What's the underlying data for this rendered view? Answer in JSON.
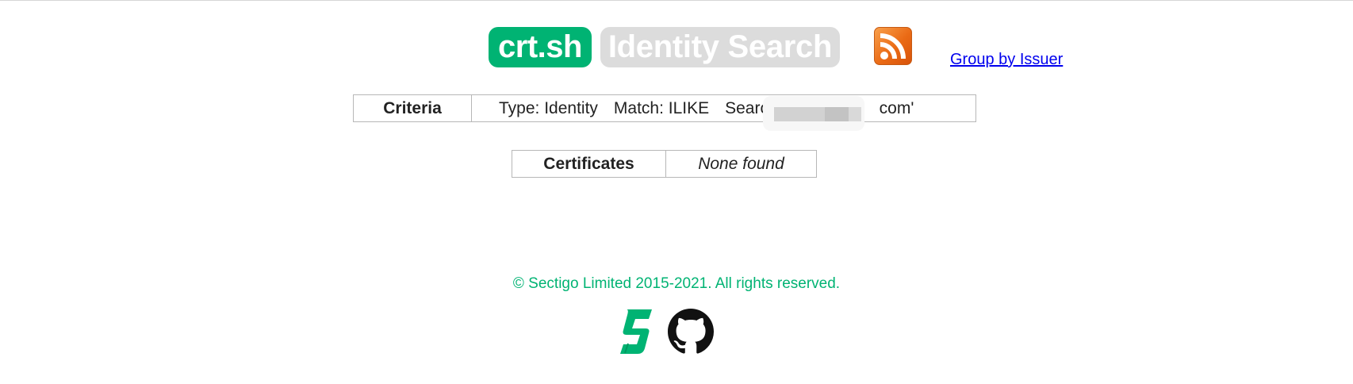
{
  "header": {
    "brand": "crt.sh",
    "title": "Identity Search",
    "group_by_link": "Group by Issuer"
  },
  "criteria": {
    "label": "Criteria",
    "type": "Type: Identity",
    "match": "Match: ILIKE",
    "search_prefix": "Search",
    "search_suffix": "com'"
  },
  "certificates": {
    "label": "Certificates",
    "value": "None found"
  },
  "footer": {
    "copyright": "© Sectigo Limited 2015-2021. All rights reserved."
  },
  "colors": {
    "brand_green": "#00b373",
    "title_gray": "#dcdcdc",
    "rss_orange": "#ea6a15",
    "link_blue": "#0000ee"
  },
  "icons": [
    "rss-icon",
    "sectigo-icon",
    "github-icon"
  ]
}
